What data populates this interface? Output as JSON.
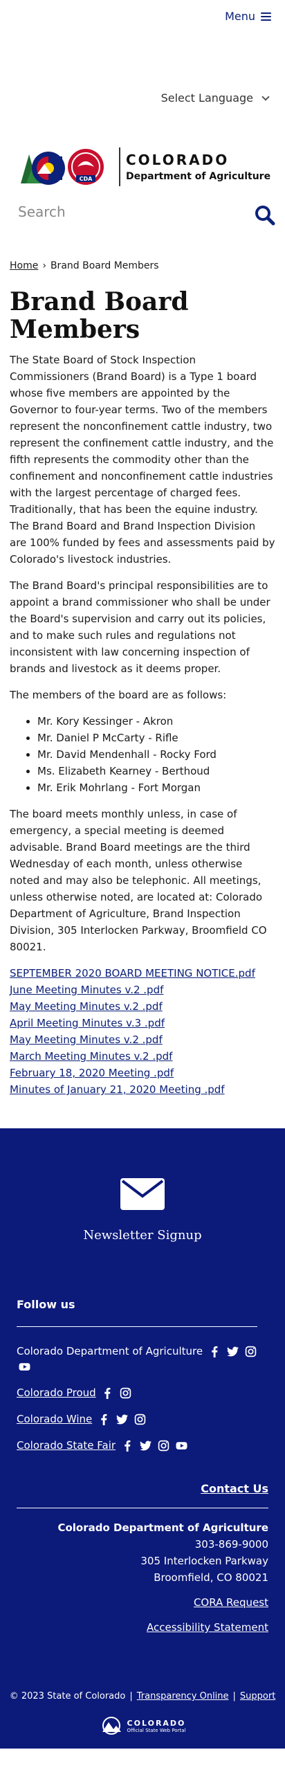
{
  "header": {
    "menu_label": "Menu",
    "language_label": "Select Language",
    "logo_title": "COLORADO",
    "logo_subtitle": "Department of Agriculture",
    "logo_badge": "CDA"
  },
  "search": {
    "placeholder": "Search"
  },
  "breadcrumb": {
    "home": "Home",
    "separator": "›",
    "current": "Brand Board Members"
  },
  "page": {
    "title": "Brand Board Members",
    "paragraphs": [
      "The State Board of Stock Inspection Commissioners (Brand Board) is a Type 1 board whose five members are appointed by the Governor to four-year terms. Two of the members represent the nonconfinement cattle industry, two represent the confinement cattle industry, and the fifth represents the commodity other than the confinement and nonconfinement cattle industries with the largest percentage of charged fees. Traditionally, that has been the equine industry. The Brand Board and Brand Inspection Division are 100% funded by fees and assessments paid by Colorado's livestock industries.",
      "The Brand Board's principal responsibilities are to appoint a brand commissioner who shall be under the Board's supervision and carry out its policies, and to make such rules and regulations not inconsistent with law concerning inspection of brands and livestock as it deems proper.",
      "The members of the board are as follows:"
    ],
    "members": [
      "Mr. Kory Kessinger - Akron",
      "Mr. Daniel P McCarty - Rifle",
      "Mr. David Mendenhall - Rocky Ford",
      "Ms. Elizabeth Kearney - Berthoud",
      "Mr. Erik Mohrlang - Fort Morgan"
    ],
    "closing": "The board meets monthly unless, in case of emergency, a special meeting is deemed advisable. Brand Board meetings are the third Wednesday of each month, unless otherwise noted and may also be telephonic. All meetings, unless otherwise noted, are located at: Colorado Department of Agriculture, Brand Inspection Division, 305 Interlocken Parkway, Broomfield CO 80021.",
    "documents": [
      "SEPTEMBER 2020 BOARD MEETING NOTICE.pdf",
      "June Meeting Minutes v.2 .pdf",
      "May Meeting Minutes v.2 .pdf",
      "April Meeting Minutes v.3 .pdf",
      "May Meeting Minutes v.2 .pdf",
      "March Meeting Minutes v.2 .pdf",
      "February 18, 2020 Meeting .pdf",
      "Minutes of January 21, 2020 Meeting .pdf"
    ]
  },
  "footer": {
    "newsletter_label": "Newsletter Signup",
    "follow_heading": "Follow us",
    "social": [
      {
        "label": "Colorado Department of Agriculture",
        "icons": [
          "facebook-icon",
          "twitter-icon",
          "instagram-icon",
          "youtube-icon"
        ]
      },
      {
        "label": "Colorado Proud",
        "icons": [
          "facebook-icon",
          "instagram-icon"
        ]
      },
      {
        "label": "Colorado Wine",
        "icons": [
          "facebook-icon",
          "twitter-icon",
          "instagram-icon"
        ]
      },
      {
        "label": "Colorado State Fair",
        "icons": [
          "facebook-icon",
          "twitter-icon",
          "instagram-icon",
          "youtube-icon"
        ]
      }
    ],
    "contact_label": "Contact Us",
    "org_name": "Colorado Department of Agriculture",
    "phone": "303-869-9000",
    "address1": "305 Interlocken Parkway",
    "address2": "Broomfield, CO 80021",
    "cora_label": "CORA Request",
    "accessibility_label": "Accessibility Statement",
    "copyright": "© 2023 State of Colorado",
    "transparency_label": "Transparency Online",
    "support_label": "Support",
    "state_logo_title": "COLORADO",
    "state_logo_subtitle": "Official State Web Portal"
  },
  "colors": {
    "navy": "#0c1a7a",
    "link": "#0c2179"
  }
}
